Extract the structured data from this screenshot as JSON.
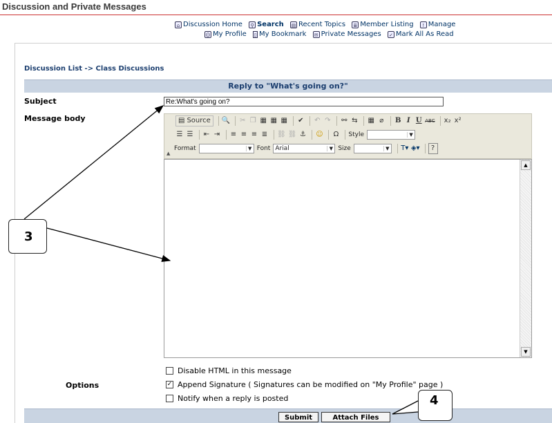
{
  "app_title": "Discussion and Private Messages",
  "nav": {
    "row1": [
      {
        "label": "Discussion Home",
        "icon": "home-icon",
        "bold": false
      },
      {
        "label": "Search",
        "icon": "search-icon",
        "bold": true
      },
      {
        "label": "Recent Topics",
        "icon": "recent-topics-icon",
        "bold": false
      },
      {
        "label": "Member Listing",
        "icon": "member-listing-icon",
        "bold": false
      },
      {
        "label": "Manage",
        "icon": "manage-icon",
        "bold": false
      }
    ],
    "row2": [
      {
        "label": "My Profile",
        "icon": "profile-icon"
      },
      {
        "label": "My Bookmark",
        "icon": "bookmark-icon"
      },
      {
        "label": "Private Messages",
        "icon": "private-messages-icon"
      },
      {
        "label": "Mark All As Read",
        "icon": "mark-read-icon"
      }
    ]
  },
  "breadcrumb": "Discussion List -> Class Discussions",
  "reply_header": "Reply to \"What's going on?\"",
  "subject": {
    "label": "Subject",
    "value": "Re:What's going on?"
  },
  "message_body_label": "Message body",
  "toolbar": {
    "source_label": "Source",
    "style_label": "Style",
    "format_label": "Format",
    "font_label": "Font",
    "font_value": "Arial",
    "size_label": "Size"
  },
  "options": {
    "label": "Options",
    "items": [
      {
        "label": "Disable HTML in this message",
        "checked": false
      },
      {
        "label": "Append Signature ( Signatures can be modified on \"My Profile\" page )",
        "checked": true
      },
      {
        "label": "Notify when a reply is posted",
        "checked": false
      }
    ]
  },
  "buttons": {
    "submit": "Submit",
    "attach": "Attach Files"
  },
  "callouts": {
    "three": "3",
    "four": "4"
  },
  "colors": {
    "header_bg": "#c9d4e2",
    "link": "#1a3d6e",
    "title_rule": "#cc3333",
    "toolbar_bg": "#eae8dc"
  }
}
